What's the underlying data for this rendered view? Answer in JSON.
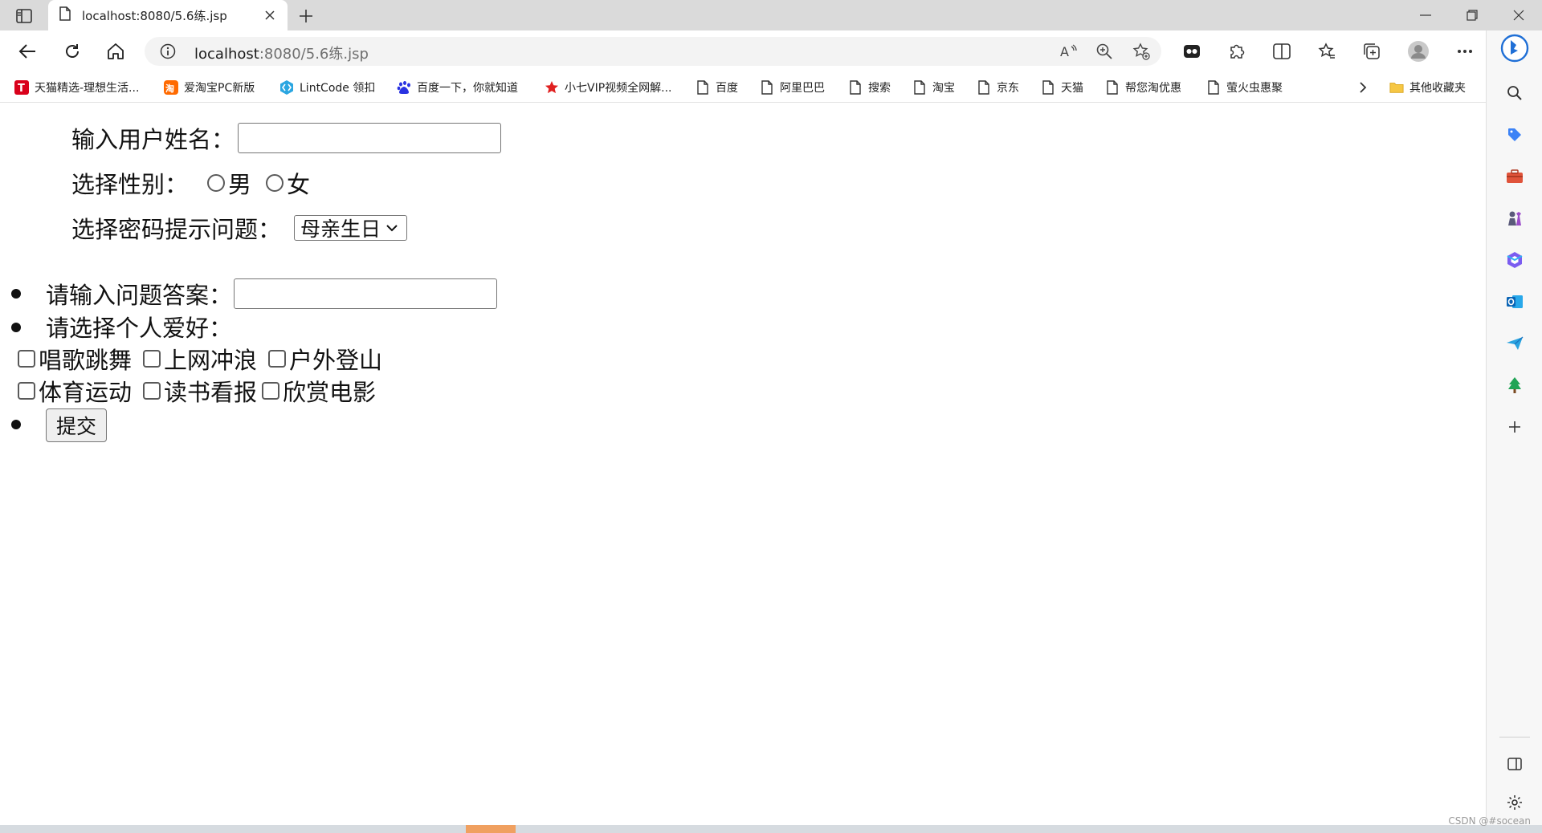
{
  "tab": {
    "title": "localhost:8080/5.6练.jsp"
  },
  "address_bar": {
    "host": "localhost",
    "path": ":8080/5.6练.jsp"
  },
  "favorites": [
    {
      "label": "天猫精选-理想生活...",
      "icon": "tmall-logo-icon"
    },
    {
      "label": "爱淘宝PC新版",
      "icon": "aitaobao-logo-icon"
    },
    {
      "label": "LintCode 领扣",
      "icon": "lintcode-logo-icon"
    },
    {
      "label": "百度一下，你就知道",
      "icon": "baidu-paw-icon"
    },
    {
      "label": "小七VIP视频全网解...",
      "icon": "star-icon"
    },
    {
      "label": "百度",
      "icon": "page-icon"
    },
    {
      "label": "阿里巴巴",
      "icon": "page-icon"
    },
    {
      "label": "搜索",
      "icon": "page-icon"
    },
    {
      "label": "淘宝",
      "icon": "page-icon"
    },
    {
      "label": "京东",
      "icon": "page-icon"
    },
    {
      "label": "天猫",
      "icon": "page-icon"
    },
    {
      "label": "帮您淘优惠",
      "icon": "page-icon"
    },
    {
      "label": "萤火虫惠聚",
      "icon": "page-icon"
    }
  ],
  "other_favorites": {
    "label": "其他收藏夹"
  },
  "form": {
    "username_label": "输入用户姓名：",
    "username_value": "",
    "gender_label": "选择性别：",
    "gender_options": [
      "男",
      "女"
    ],
    "question_label": "选择密码提示问题：",
    "question_selected": "母亲生日",
    "answer_label": "请输入问题答案：",
    "answer_value": "",
    "hobby_label": "请选择个人爱好：",
    "hobbies": [
      "唱歌跳舞",
      "上网冲浪",
      "户外登山",
      "体育运动",
      "读书看报",
      "欣赏电影"
    ],
    "submit_label": "提交"
  },
  "watermark": "CSDN @#socean",
  "colors": {
    "accent_blue": "#0c59a4",
    "tab_strip": "#dadada",
    "omnibox": "#f3f3f3"
  }
}
